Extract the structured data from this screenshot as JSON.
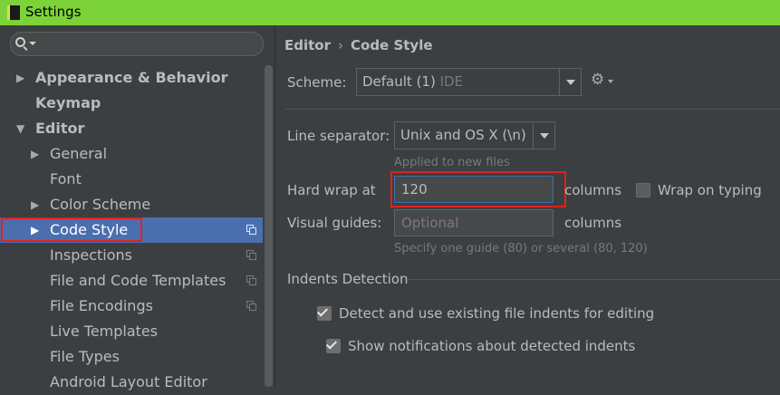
{
  "window": {
    "title": "Settings"
  },
  "search": {
    "placeholder": ""
  },
  "sidebar": {
    "items": [
      {
        "label": "Appearance & Behavior",
        "arrow": "▶"
      },
      {
        "label": "Keymap"
      },
      {
        "label": "Editor",
        "arrow": "▼"
      },
      {
        "label": "General",
        "arrow": "▶"
      },
      {
        "label": "Font"
      },
      {
        "label": "Color Scheme",
        "arrow": "▶"
      },
      {
        "label": "Code Style",
        "arrow": "▶",
        "selected": true
      },
      {
        "label": "Inspections"
      },
      {
        "label": "File and Code Templates"
      },
      {
        "label": "File Encodings"
      },
      {
        "label": "Live Templates"
      },
      {
        "label": "File Types"
      },
      {
        "label": "Android Layout Editor"
      }
    ]
  },
  "breadcrumb": {
    "parent": "Editor",
    "separator": "›",
    "current": "Code Style"
  },
  "scheme": {
    "label": "Scheme:",
    "value": "Default (1)",
    "suffix": "IDE"
  },
  "line_separator": {
    "label": "Line separator:",
    "value": "Unix and OS X (\\n)",
    "hint": "Applied to new files"
  },
  "hard_wrap": {
    "label": "Hard wrap at",
    "value": "120",
    "units": "columns"
  },
  "wrap_on_typing": {
    "label": "Wrap on typing",
    "checked": false
  },
  "visual_guides": {
    "label": "Visual guides:",
    "placeholder": "Optional",
    "units": "columns",
    "hint": "Specify one guide (80) or several (80, 120)"
  },
  "indents_detection": {
    "title": "Indents Detection",
    "detect": {
      "label": "Detect and use existing file indents for editing",
      "checked": true
    },
    "notify": {
      "label": "Show notifications about detected indents",
      "checked": true
    }
  },
  "colors": {
    "selection": "#4b6eaf",
    "highlight_border": "#e02020",
    "titlebar": "#7cd339",
    "background": "#3c3f41"
  }
}
